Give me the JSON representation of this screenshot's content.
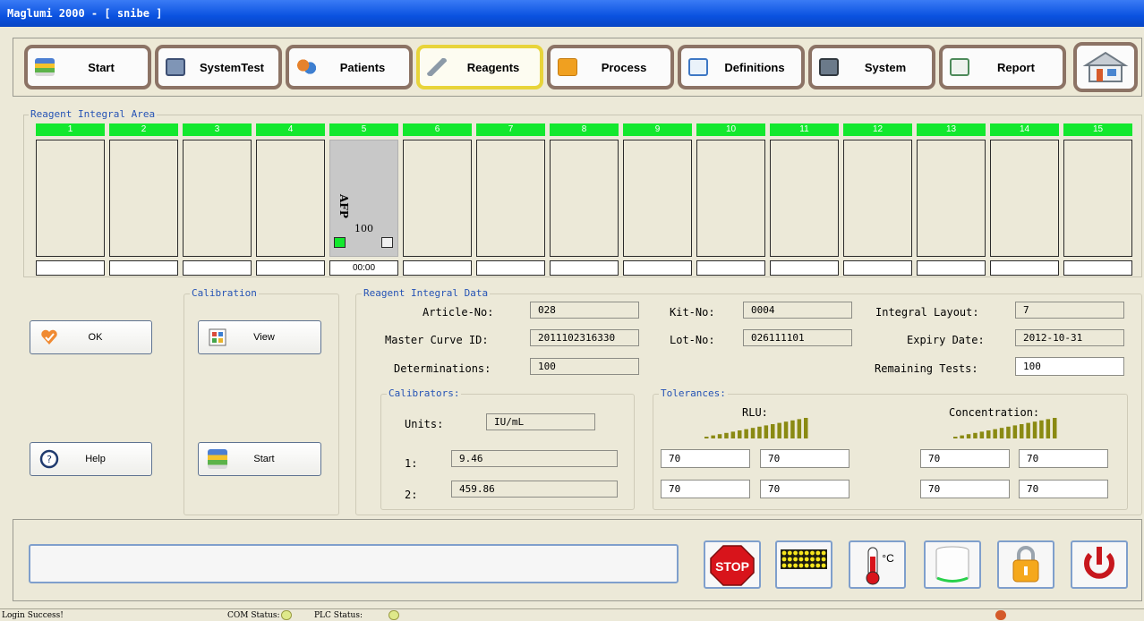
{
  "window": {
    "title": "Maglumi 2000 - [ snibe ]"
  },
  "toolbar": {
    "buttons": [
      {
        "label": "Start",
        "icon": "start-icon"
      },
      {
        "label": "SystemTest",
        "icon": "systemtest-icon"
      },
      {
        "label": "Patients",
        "icon": "patients-icon"
      },
      {
        "label": "Reagents",
        "icon": "reagents-icon",
        "active": true
      },
      {
        "label": "Process",
        "icon": "process-icon"
      },
      {
        "label": "Definitions",
        "icon": "definitions-icon"
      },
      {
        "label": "System",
        "icon": "system-icon"
      },
      {
        "label": "Report",
        "icon": "report-icon"
      }
    ],
    "home_icon": "home-icon"
  },
  "reagent_area": {
    "legend": "Reagent Integral Area",
    "slots": [
      "1",
      "2",
      "3",
      "4",
      "5",
      "6",
      "7",
      "8",
      "9",
      "10",
      "11",
      "12",
      "13",
      "14",
      "15"
    ],
    "loaded_slot": {
      "name": "AFP",
      "count": "100",
      "time": "00:00"
    }
  },
  "actions": {
    "ok_label": "OK",
    "help_label": "Help"
  },
  "calibration": {
    "legend": "Calibration",
    "view_label": "View",
    "start_label": "Start"
  },
  "data": {
    "legend": "Reagent Integral Data",
    "article_no_label": "Article-No:",
    "article_no": "028",
    "kit_no_label": "Kit-No:",
    "kit_no": "0004",
    "integral_layout_label": "Integral Layout:",
    "integral_layout": "7",
    "master_curve_label": "Master Curve ID:",
    "master_curve": "2011102316330",
    "lot_no_label": "Lot-No:",
    "lot_no": "026111101",
    "expiry_label": "Expiry Date:",
    "expiry": "2012-10-31",
    "determinations_label": "Determinations:",
    "determinations": "100",
    "remaining_label": "Remaining Tests:",
    "remaining": "100"
  },
  "calibrators": {
    "legend": "Calibrators:",
    "units_label": "Units:",
    "units": "IU/mL",
    "row1_label": "1:",
    "row1": "9.46",
    "row2_label": "2:",
    "row2": "459.86"
  },
  "tolerances": {
    "legend": "Tolerances:",
    "rlu_label": "RLU:",
    "conc_label": "Concentration:",
    "rlu": [
      [
        "70",
        "70"
      ],
      [
        "70",
        "70"
      ]
    ],
    "conc": [
      [
        "70",
        "70"
      ],
      [
        "70",
        "70"
      ]
    ]
  },
  "bottom": {
    "stop_label": "STOP",
    "temp_unit": "°C"
  },
  "status": {
    "login": "Login Success!",
    "com": "COM Status:",
    "plc": "PLC Status:"
  },
  "colors": {
    "slot_header": "#13e82e",
    "active_border": "#e8d43a",
    "stop_red": "#d8141b"
  }
}
